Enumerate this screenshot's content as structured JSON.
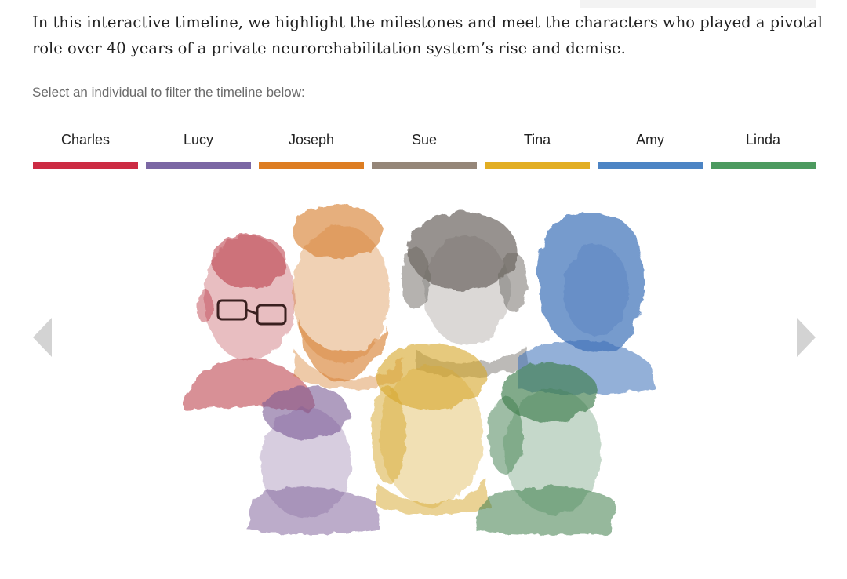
{
  "intro_text": "In this interactive timeline, we highlight the milestones and meet the characters who played a pivotal role over 40 years of a private neurorehabilitation system’s rise and demise.",
  "filter_prompt": "Select an individual to filter the timeline below:",
  "individuals": [
    {
      "name": "Charles",
      "color": "#cc2b43"
    },
    {
      "name": "Lucy",
      "color": "#7b67a4"
    },
    {
      "name": "Joseph",
      "color": "#dd7d22"
    },
    {
      "name": "Sue",
      "color": "#958678"
    },
    {
      "name": "Tina",
      "color": "#e2ae23"
    },
    {
      "name": "Amy",
      "color": "#4c84c4"
    },
    {
      "name": "Linda",
      "color": "#4c9a5f"
    }
  ],
  "portrait_colors": {
    "charles": "#b8343f",
    "joseph": "#d57a28",
    "sue": "#6b6560",
    "amy": "#3c6fb8",
    "lucy": "#7a5a95",
    "tina": "#d6a528",
    "linda": "#3e7d4b"
  },
  "icons": {
    "prev": "chevron-left-icon",
    "next": "chevron-right-icon"
  }
}
